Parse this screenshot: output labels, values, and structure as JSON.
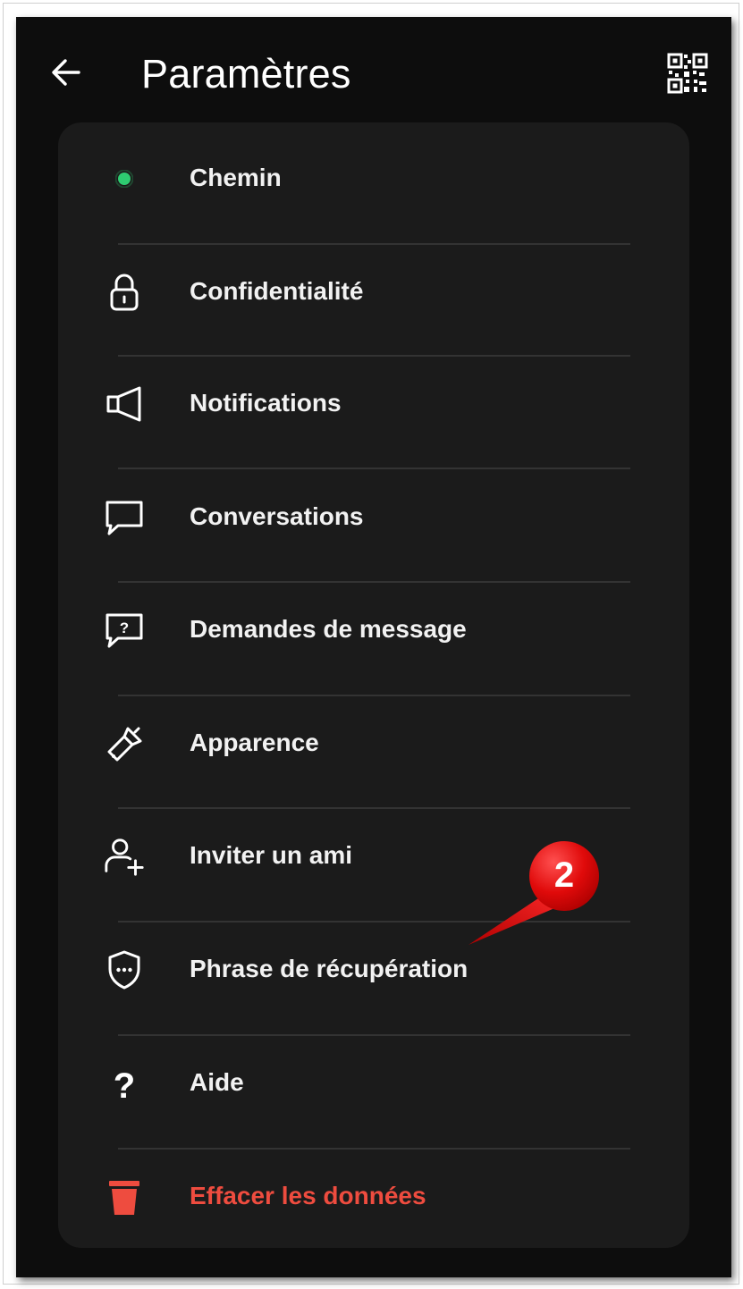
{
  "header": {
    "title": "Paramètres",
    "back_icon": "arrow-left-icon",
    "qr_icon": "qr-code-icon"
  },
  "menu": {
    "items": [
      {
        "label": "Chemin",
        "icon": "status-dot-icon",
        "icon_color": "#2ecc71"
      },
      {
        "label": "Confidentialité",
        "icon": "lock-icon"
      },
      {
        "label": "Notifications",
        "icon": "megaphone-icon"
      },
      {
        "label": "Conversations",
        "icon": "chat-bubble-icon"
      },
      {
        "label": "Demandes de message",
        "icon": "chat-question-icon"
      },
      {
        "label": "Apparence",
        "icon": "paintbrush-icon"
      },
      {
        "label": "Inviter un ami",
        "icon": "add-user-icon"
      },
      {
        "label": "Phrase de récupération",
        "icon": "shield-dots-icon"
      },
      {
        "label": "Aide",
        "icon": "question-mark-icon"
      },
      {
        "label": "Effacer les données",
        "icon": "trash-icon",
        "danger": true,
        "icon_color": "#ee4c3f"
      }
    ]
  },
  "annotation": {
    "step_number": "2",
    "color": "#e00a0a"
  },
  "colors": {
    "background": "#0d0d0d",
    "card": "#1b1b1b",
    "text": "#f2f2f2",
    "danger": "#ee4c3f",
    "accent": "#2ecc71"
  }
}
